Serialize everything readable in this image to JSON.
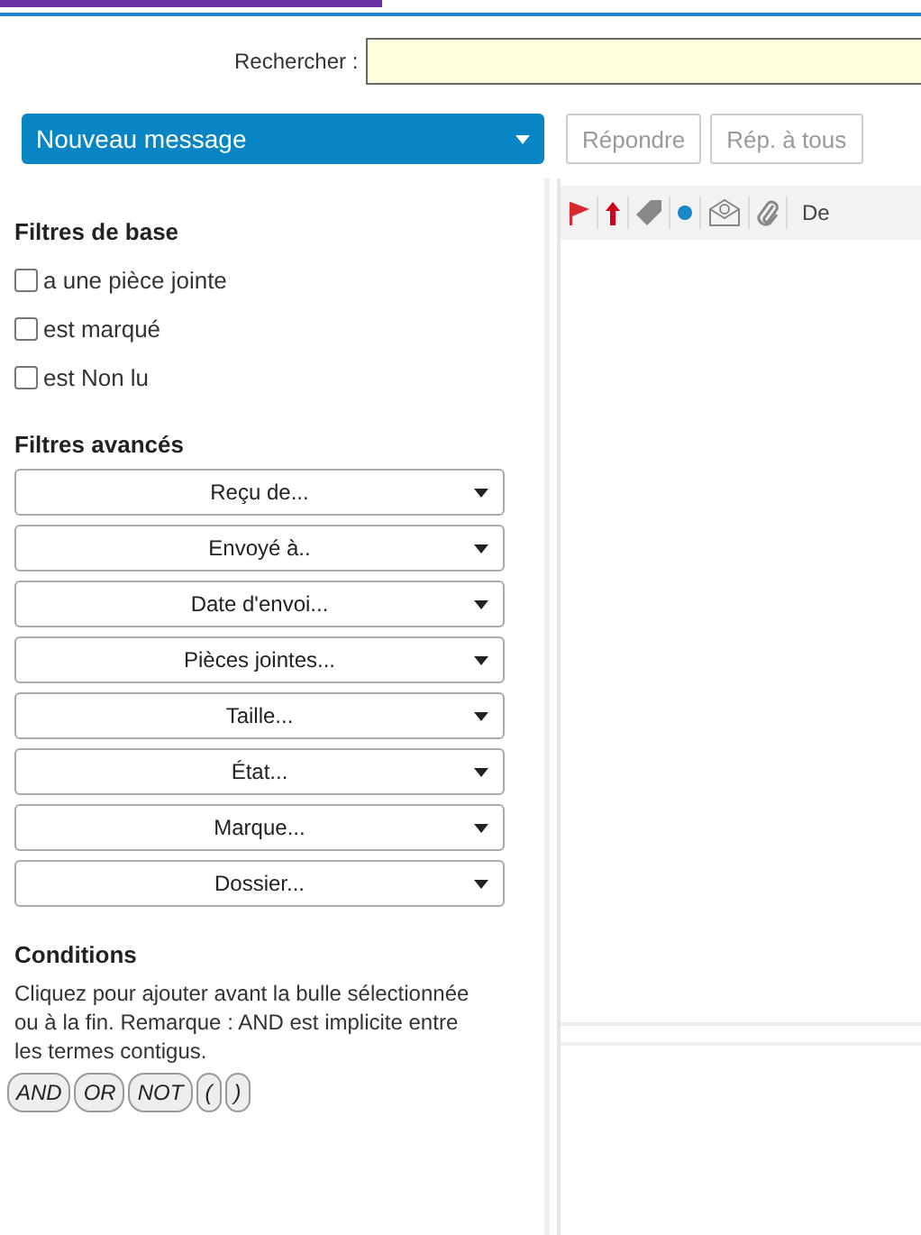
{
  "search": {
    "label": "Rechercher :"
  },
  "toolbar": {
    "new_message": "Nouveau message",
    "buttons": [
      {
        "label": "Répondre",
        "disabled": true
      },
      {
        "label": "Rép. à tous",
        "disabled": true
      }
    ]
  },
  "basic_filters": {
    "title": "Filtres de base",
    "items": [
      {
        "label": "a une pièce jointe",
        "checked": false
      },
      {
        "label": "est marqué",
        "checked": false
      },
      {
        "label": "est Non lu",
        "checked": false
      }
    ]
  },
  "advanced_filters": {
    "title": "Filtres avancés",
    "dropdowns": [
      "Reçu de...",
      "Envoyé à..",
      "Date d'envoi...",
      "Pièces jointes...",
      "Taille...",
      "État...",
      "Marque...",
      "Dossier..."
    ]
  },
  "conditions": {
    "title": "Conditions",
    "note": "Cliquez pour ajouter avant la bulle sélectionnée ou à la fin. Remarque : AND est implicite entre les termes contigus.",
    "bubbles": [
      "AND",
      "OR",
      "NOT",
      "(",
      ")"
    ]
  },
  "message_list": {
    "columns": [
      {
        "kind": "flag"
      },
      {
        "kind": "priority"
      },
      {
        "kind": "tag"
      },
      {
        "kind": "unread"
      },
      {
        "kind": "status"
      },
      {
        "kind": "attachment"
      },
      {
        "kind": "text",
        "label": "De"
      }
    ]
  }
}
